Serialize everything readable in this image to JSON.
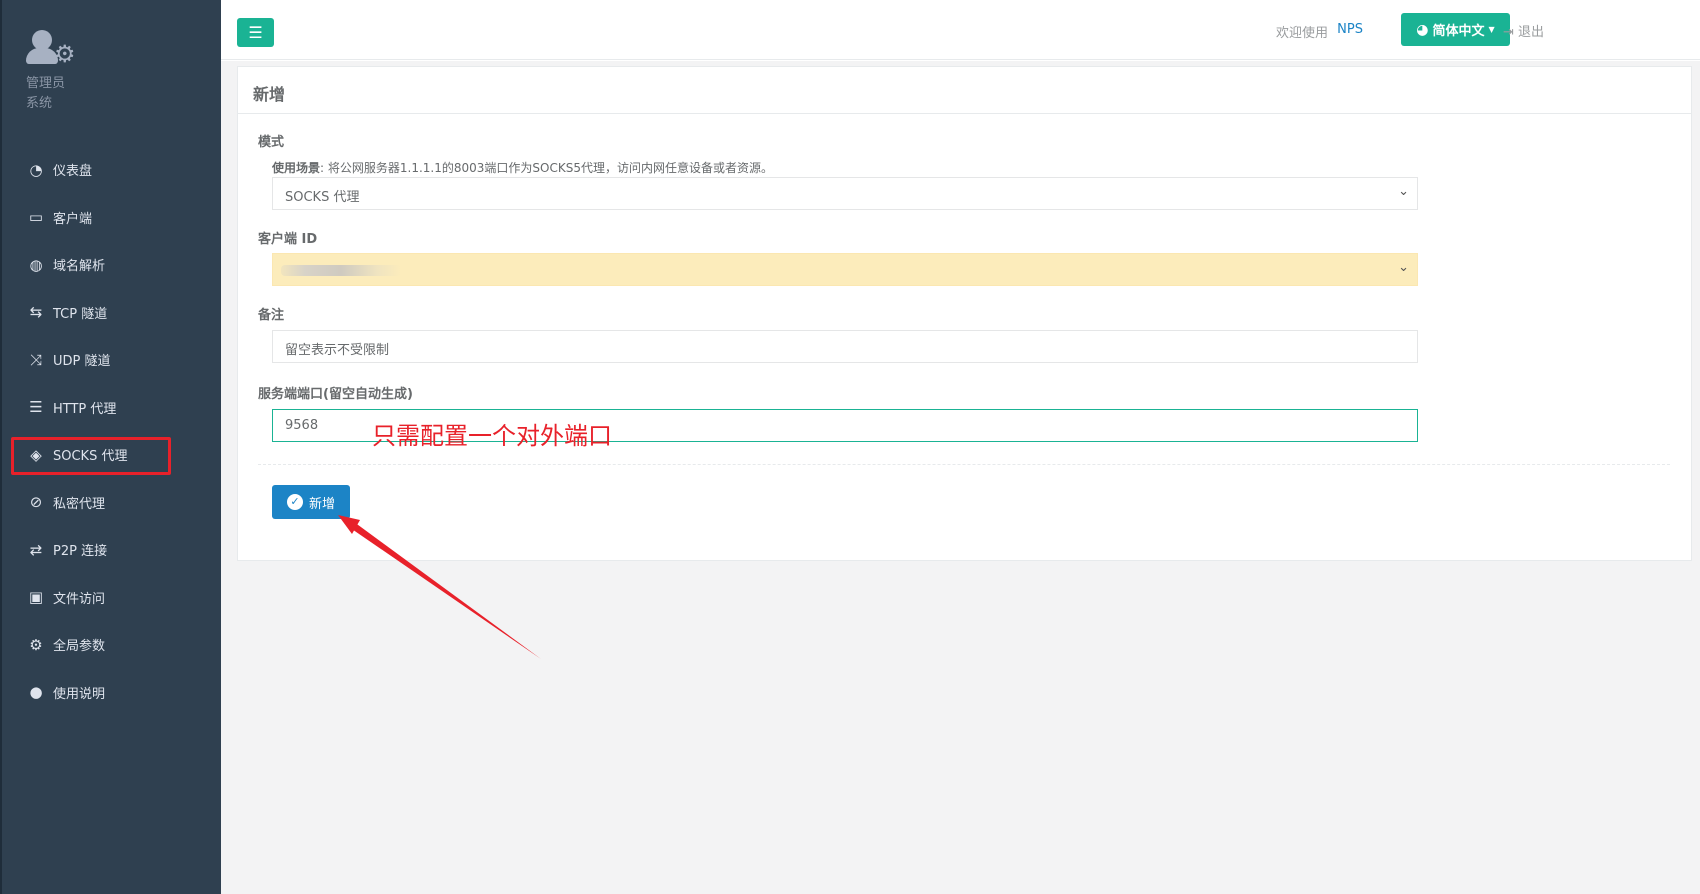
{
  "sidebar": {
    "profile": {
      "role": "管理员",
      "system": "系统"
    },
    "items": [
      {
        "label": "仪表盘",
        "icon": "dashboard-icon",
        "glyph": "◔"
      },
      {
        "label": "客户端",
        "icon": "monitor-icon",
        "glyph": "▭"
      },
      {
        "label": "域名解析",
        "icon": "globe-icon",
        "glyph": "◍"
      },
      {
        "label": "TCP 隧道",
        "icon": "retweet-icon",
        "glyph": "⇆"
      },
      {
        "label": "UDP 隧道",
        "icon": "random-icon",
        "glyph": "⤨"
      },
      {
        "label": "HTTP 代理",
        "icon": "server-icon",
        "glyph": "☰"
      },
      {
        "label": "SOCKS 代理",
        "icon": "layers-icon",
        "glyph": "◈"
      },
      {
        "label": "私密代理",
        "icon": "eye-slash-icon",
        "glyph": "⊘"
      },
      {
        "label": "P2P 连接",
        "icon": "exchange-icon",
        "glyph": "⇄"
      },
      {
        "label": "文件访问",
        "icon": "briefcase-icon",
        "glyph": "▣"
      },
      {
        "label": "全局参数",
        "icon": "gear-icon",
        "glyph": "⚙"
      },
      {
        "label": "使用说明",
        "icon": "lightbulb-icon",
        "glyph": "●"
      }
    ],
    "active_index": 6
  },
  "topbar": {
    "menu_icon": "☰",
    "welcome": "欢迎使用",
    "brand": "NPS",
    "language": "简体中文",
    "logout": "退出"
  },
  "form": {
    "title": "新增",
    "mode_label": "模式",
    "usage_prefix": "使用场景",
    "usage_text": ": 将公网服务器1.1.1.1的8003端口作为SOCKS5代理，访问内网任意设备或者资源。",
    "mode_value": "SOCKS 代理",
    "client_label": "客户端 ID",
    "remark_label": "备注",
    "remark_placeholder": "留空表示不受限制",
    "port_label": "服务端端口(留空自动生成)",
    "port_value": "9568",
    "submit_label": "新增"
  },
  "annotation": {
    "text": "只需配置一个对外端口",
    "color": "#e8212a"
  },
  "colors": {
    "sidebar": "#2f4050",
    "primary": "#1ab394",
    "submit": "#1c84c6",
    "highlight": "#e8212a"
  }
}
